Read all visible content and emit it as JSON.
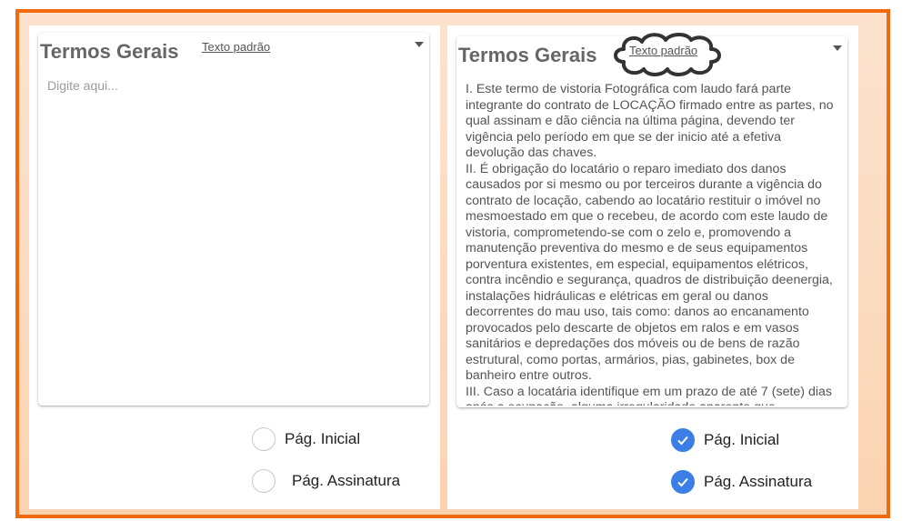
{
  "left_panel": {
    "title": "Termos Gerais",
    "default_link": "Texto padrão",
    "placeholder": "Digite aqui...",
    "options": [
      {
        "label": "Pág. Inicial",
        "checked": false
      },
      {
        "label": "Pág. Assinatura",
        "checked": false
      }
    ]
  },
  "right_panel": {
    "title": "Termos Gerais",
    "default_link": "Texto padrão",
    "body": "I. Este termo de vistoria Fotográfica com laudo fará parte integrante do contrato de LOCAÇÃO firmado entre as partes, no qual assinam e dão ciência na última página, devendo ter vigência pelo período em que se der inicio até a efetiva devolução das chaves.\nII. É obrigação do locatário o reparo imediato dos danos causados por si mesmo ou por terceiros durante a vigência do contrato de locação, cabendo ao locatário restituir o imóvel no mesmoestado em que o recebeu, de acordo com este laudo de vistoria, comprometendo-se com o zelo e, promovendo a manutenção preventiva do mesmo e de seus equipamentos porventura existentes, em especial, equipamentos elétricos, contra incêndio e segurança, quadros de distribuição deenergia, instalações hidráulicas e elétricas em geral ou danos decorrentes do mau uso, tais como: danos ao encanamento provocados pelo descarte de objetos em ralos e em vasos sanitários e depredações dos móveis ou de bens de razão estrutural, como portas, armários, pias, gabinetes, box de banheiro entre outros.\nIII. Caso a locatária identifique em um prazo de até 7 (sete) dias após a ocupação, alguma irregularidade aparente que",
    "options": [
      {
        "label": "Pág. Inicial",
        "checked": true
      },
      {
        "label": "Pág. Assinatura",
        "checked": true
      }
    ]
  },
  "colors": {
    "frame_border": "#f26a10",
    "check_blue": "#3b7fe6"
  },
  "icons": [
    "chevron-down-icon",
    "checkmark-icon",
    "cloud-highlight"
  ]
}
